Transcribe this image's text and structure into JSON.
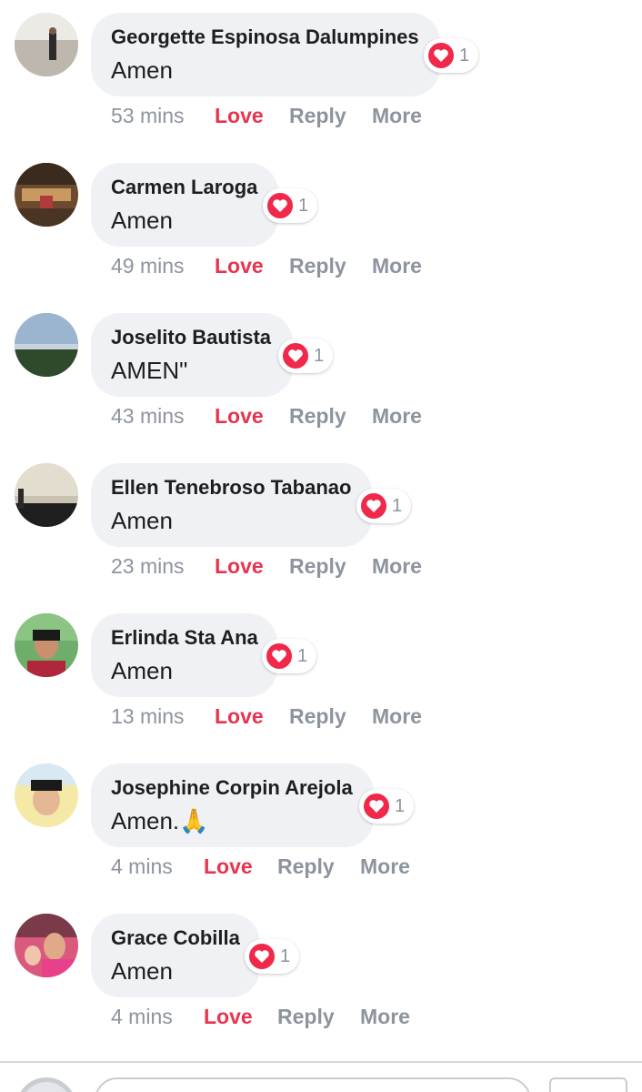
{
  "colors": {
    "bubble": "#eff1f4",
    "love": "#e8344e",
    "heart": "#f0284a",
    "muted": "#8d949e",
    "text": "#1c1e21"
  },
  "comments": [
    {
      "author": "Georgette Espinosa Dalumpines",
      "text": "Amen",
      "reaction_icon": "heart-icon",
      "reaction_count": "1",
      "time": "53 mins",
      "love_label": "Love",
      "reply_label": "Reply",
      "more_label": "More"
    },
    {
      "author": "Carmen Laroga",
      "text": "Amen",
      "reaction_icon": "heart-icon",
      "reaction_count": "1",
      "time": "49 mins",
      "love_label": "Love",
      "reply_label": "Reply",
      "more_label": "More"
    },
    {
      "author": "Joselito Bautista",
      "text": "AMEN\"",
      "reaction_icon": "heart-icon",
      "reaction_count": "1",
      "time": "43 mins",
      "love_label": "Love",
      "reply_label": "Reply",
      "more_label": "More"
    },
    {
      "author": "Ellen Tenebroso Tabanao",
      "text": "Amen",
      "reaction_icon": "heart-icon",
      "reaction_count": "1",
      "time": "23 mins",
      "love_label": "Love",
      "reply_label": "Reply",
      "more_label": "More"
    },
    {
      "author": "Erlinda Sta Ana",
      "text": "Amen",
      "reaction_icon": "heart-icon",
      "reaction_count": "1",
      "time": "13 mins",
      "love_label": "Love",
      "reply_label": "Reply",
      "more_label": "More"
    },
    {
      "author": "Josephine Corpin Arejola",
      "text": "Amen.🙏",
      "reaction_icon": "heart-icon",
      "reaction_count": "1",
      "time": "4 mins",
      "love_label": "Love",
      "reply_label": "Reply",
      "more_label": "More"
    },
    {
      "author": "Grace Cobilla",
      "text": "Amen",
      "reaction_icon": "heart-icon",
      "reaction_count": "1",
      "time": "4 mins",
      "love_label": "Love",
      "reply_label": "Reply",
      "more_label": "More"
    }
  ]
}
